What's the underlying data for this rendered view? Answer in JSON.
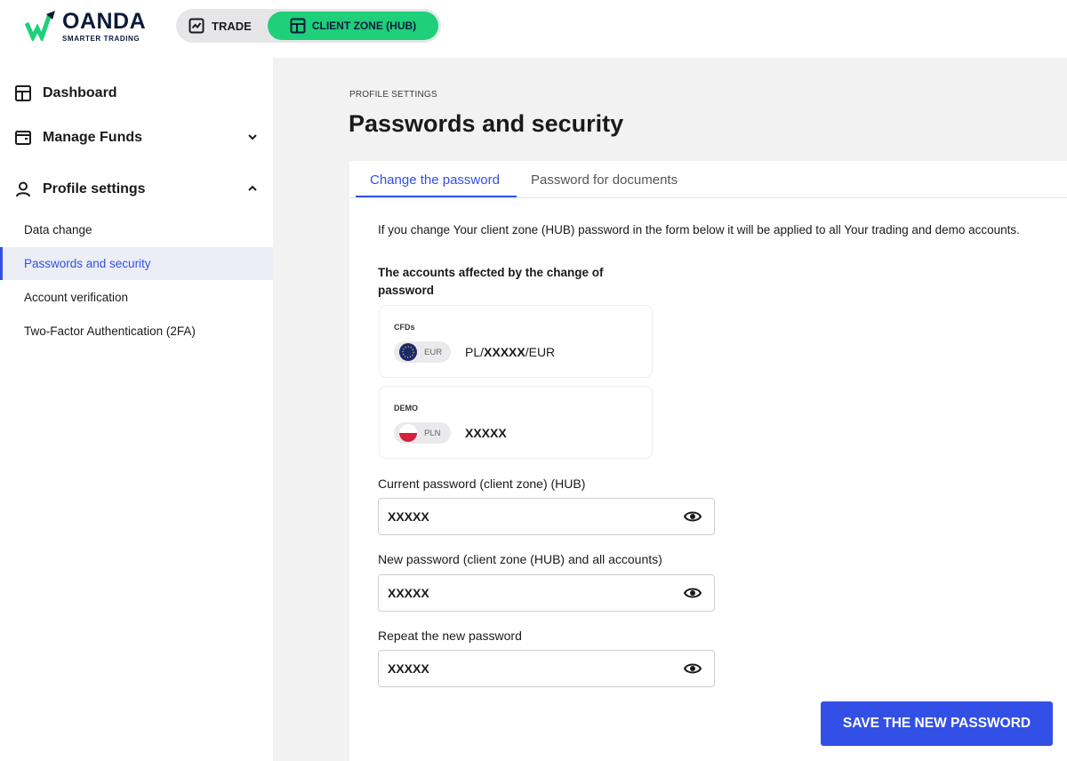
{
  "brand": {
    "name": "OANDA",
    "tagline": "SMARTER TRADING"
  },
  "switcher": {
    "trade_label": "TRADE",
    "hub_label": "CLIENT ZONE (HUB)"
  },
  "sidebar": {
    "dashboard": "Dashboard",
    "manage_funds": "Manage Funds",
    "profile_settings": "Profile settings",
    "sub_items": [
      "Data change",
      "Passwords and security",
      "Account verification",
      "Two-Factor Authentication (2FA)"
    ]
  },
  "page": {
    "breadcrumb": "PROFILE SETTINGS",
    "title": "Passwords and security"
  },
  "tabs": [
    "Change the password",
    "Password for documents"
  ],
  "form": {
    "info": "If you change Your client zone (HUB) password in the form below it will be applied to all Your trading and demo accounts.",
    "affected_heading": "The accounts affected by the change of password",
    "accounts": [
      {
        "type": "CFDs",
        "currency": "EUR",
        "number_prefix": "PL/",
        "number_masked": "XXXXX",
        "number_suffix": "/EUR"
      },
      {
        "type": "DEMO",
        "currency": "PLN",
        "number_prefix": "",
        "number_masked": "XXXXX",
        "number_suffix": ""
      }
    ],
    "fields": [
      {
        "label": "Current password (client zone) (HUB)",
        "value": "XXXXX"
      },
      {
        "label": "New password (client zone (HUB) and all accounts)",
        "value": "XXXXX"
      },
      {
        "label": "Repeat the new password",
        "value": "XXXXX"
      }
    ],
    "save_label": "SAVE THE NEW PASSWORD"
  },
  "colors": {
    "accent": "#3250e6",
    "hub_green": "#1fcf7a",
    "brand_navy": "#0b1b3a"
  },
  "icons": [
    "oanda-logo-icon",
    "chart-line-icon",
    "dashboard-icon",
    "wallet-icon",
    "user-icon",
    "chevron-down-icon",
    "chevron-up-icon",
    "eu-flag-icon",
    "poland-flag-icon",
    "eye-icon"
  ]
}
